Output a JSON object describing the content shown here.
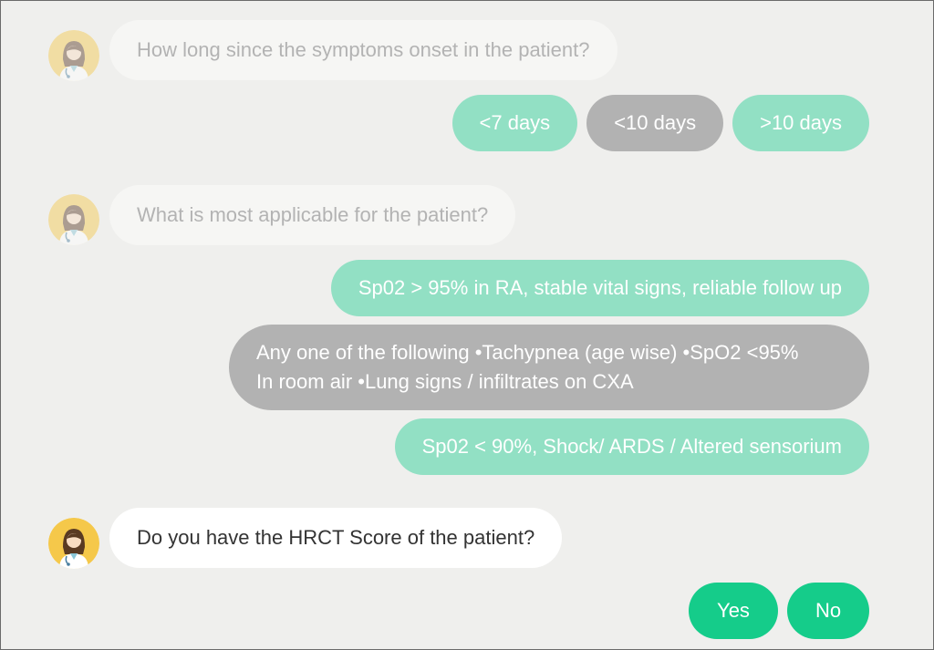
{
  "colors": {
    "background": "#efefed",
    "option_unselected": "#92e0c4",
    "option_selected": "#b2b2b2",
    "option_active": "#15cc8a",
    "bubble_faded": "#f6f6f4",
    "bubble_active": "#ffffff",
    "text_faded": "#b3b3b3",
    "text_active": "#333333",
    "avatar_bg": "#f5c84a"
  },
  "conversation": [
    {
      "question": "How long since the symptoms onset in the patient?",
      "avatar_icon": "doctor-avatar-icon",
      "options": [
        {
          "label": "<7 days",
          "state": "unselected"
        },
        {
          "label": "<10 days",
          "state": "selected"
        },
        {
          "label": ">10 days",
          "state": "unselected"
        }
      ]
    },
    {
      "question": "What is most applicable for the patient?",
      "avatar_icon": "doctor-avatar-icon",
      "options": [
        {
          "label": "Sp02 > 95% in RA, stable vital signs, reliable follow up",
          "state": "unselected"
        },
        {
          "label_line1": "Any one of the following •Tachypnea (age wise) •SpO2 <95%",
          "label_line2": "In room air •Lung signs / infiltrates on CXA",
          "state": "selected"
        },
        {
          "label": "Sp02 < 90%, Shock/ ARDS / Altered sensorium",
          "state": "unselected"
        }
      ]
    },
    {
      "question": "Do you have the HRCT Score of the patient?",
      "avatar_icon": "doctor-avatar-icon",
      "options": [
        {
          "label": "Yes",
          "state": "active"
        },
        {
          "label": "No",
          "state": "active"
        }
      ]
    }
  ]
}
